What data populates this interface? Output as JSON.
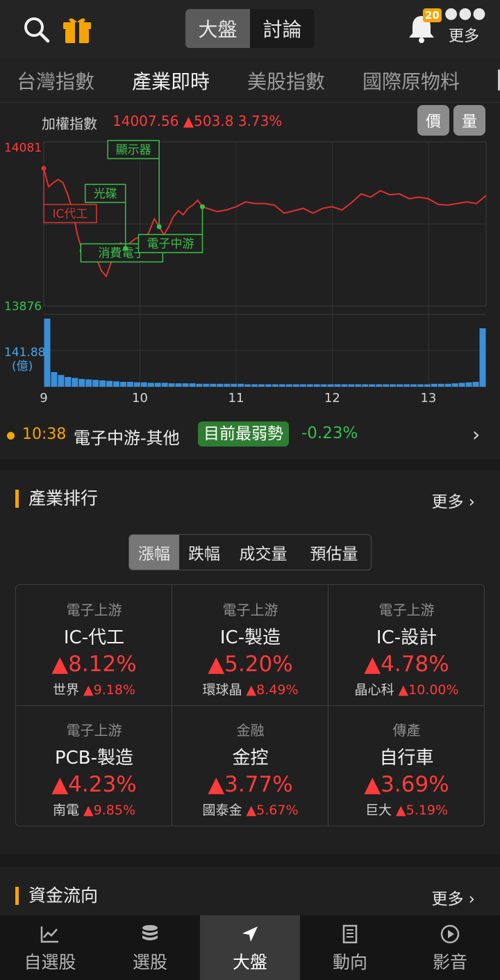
{
  "header": {
    "segments": [
      "大盤",
      "討論"
    ],
    "active_segment": "大盤",
    "notification_count": "20",
    "more_label": "更多"
  },
  "category_tabs": [
    "台灣指數",
    "產業即時",
    "美股指數",
    "國際原物料"
  ],
  "active_category": "產業即時",
  "chart_header": {
    "index_name": "加權指數",
    "index_value": "14007.56 ▲503.8 3.73%",
    "price_button": "價",
    "volume_button": "量"
  },
  "chart_data": {
    "type": "line",
    "ylim": [
      13876,
      14081
    ],
    "y_high_label": "14081",
    "y_low_label": "13876",
    "volume_max_label": "141.88",
    "volume_unit_label": "(億)",
    "x_ticks": [
      "9",
      "10",
      "11",
      "12",
      "13"
    ],
    "xlim": [
      9,
      13.6
    ],
    "series": [
      {
        "x": [
          9.0,
          9.05,
          9.1,
          9.15,
          9.2,
          9.25,
          9.3,
          9.35,
          9.4,
          9.45,
          9.5,
          9.55,
          9.6,
          9.65,
          9.7,
          9.75,
          9.8,
          9.85,
          9.9,
          9.95,
          10.0,
          10.05,
          10.1,
          10.15,
          10.2,
          10.25,
          10.3,
          10.35,
          10.4,
          10.45,
          10.5,
          10.55,
          10.6,
          10.65,
          10.7,
          10.8,
          10.9,
          11.0,
          11.1,
          11.2,
          11.3,
          11.4,
          11.5,
          11.6,
          11.7,
          11.8,
          11.9,
          12.0,
          12.1,
          12.2,
          12.3,
          12.4,
          12.5,
          12.6,
          12.7,
          12.8,
          12.9,
          13.0,
          13.1,
          13.2,
          13.3,
          13.4,
          13.5,
          13.6
        ],
        "values": [
          14048,
          14025,
          14030,
          14034,
          14030,
          14015,
          13995,
          13965,
          13945,
          13948,
          13940,
          13935,
          13920,
          13913,
          13930,
          13950,
          13955,
          13948,
          13955,
          13960,
          13962,
          13958,
          13970,
          13985,
          13975,
          13965,
          13975,
          13988,
          13995,
          13990,
          13998,
          14002,
          14008,
          14000,
          13998,
          13994,
          13996,
          14000,
          14006,
          14004,
          14004,
          14002,
          13992,
          13995,
          13998,
          13992,
          13998,
          14000,
          13996,
          14005,
          14016,
          14012,
          14020,
          14015,
          14016,
          14010,
          14012,
          14010,
          14003,
          14002,
          14004,
          14006,
          14004,
          14014
        ]
      }
    ],
    "volume": [
      140,
      30,
      24,
      20,
      18,
      16,
      15,
      14,
      13,
      12,
      11,
      10,
      10,
      9,
      9,
      8,
      8,
      8,
      7,
      7,
      7,
      7,
      6,
      6,
      6,
      6,
      6,
      6,
      6,
      5,
      5,
      5,
      5,
      5,
      5,
      5,
      5,
      5,
      5,
      5,
      5,
      5,
      5,
      5,
      5,
      5,
      5,
      5,
      5,
      5,
      5,
      5,
      5,
      5,
      5,
      5,
      6,
      6,
      6,
      7,
      8,
      9,
      10,
      120
    ],
    "annotations": [
      {
        "label": "IC代工",
        "x": 9.0,
        "value": 14048,
        "color": "#e03030"
      },
      {
        "label": "消費電子",
        "x": 9.4,
        "value": 13945,
        "color": "#3cbf4a"
      },
      {
        "label": "光碟",
        "x": 9.85,
        "value": 13948,
        "color": "#3cbf4a"
      },
      {
        "label": "顯示器",
        "x": 10.2,
        "value": 13975,
        "color": "#3cbf4a"
      },
      {
        "label": "電子中游",
        "x": 10.65,
        "value": 14000,
        "color": "#3cbf4a"
      }
    ]
  },
  "ticker": {
    "time": "10:38",
    "name": "電子中游-其他",
    "tag": "目前最弱勢",
    "change": "-0.23%"
  },
  "ranking": {
    "title": "產業排行",
    "more": "更多",
    "filters": [
      "漲幅",
      "跌幅",
      "成交量",
      "預估量"
    ],
    "active_filter": "漲幅",
    "items": [
      {
        "group": "電子上游",
        "industry": "IC-代工",
        "change": "▲8.12%",
        "leader": "世界",
        "leader_change": "▲9.18%"
      },
      {
        "group": "電子上游",
        "industry": "IC-製造",
        "change": "▲5.20%",
        "leader": "環球晶",
        "leader_change": "▲8.49%"
      },
      {
        "group": "電子上游",
        "industry": "IC-設計",
        "change": "▲4.78%",
        "leader": "晶心科",
        "leader_change": "▲10.00%"
      },
      {
        "group": "電子上游",
        "industry": "PCB-製造",
        "change": "▲4.23%",
        "leader": "南電",
        "leader_change": "▲9.85%"
      },
      {
        "group": "金融",
        "industry": "金控",
        "change": "▲3.77%",
        "leader": "國泰金",
        "leader_change": "▲5.67%"
      },
      {
        "group": "傳產",
        "industry": "自行車",
        "change": "▲3.69%",
        "leader": "巨大",
        "leader_change": "▲5.19%"
      }
    ]
  },
  "capital_flow": {
    "title": "資金流向",
    "more": "更多"
  },
  "bottom_nav": [
    {
      "label": "自選股",
      "icon": "chart-line-icon"
    },
    {
      "label": "選股",
      "icon": "database-icon"
    },
    {
      "label": "大盤",
      "icon": "navigation-arrow-icon"
    },
    {
      "label": "動向",
      "icon": "building-icon"
    },
    {
      "label": "影音",
      "icon": "play-circle-icon"
    }
  ],
  "active_nav": "大盤",
  "colors": {
    "up": "#ff3b3b",
    "down": "#33c14f",
    "accent": "#f6a400",
    "volume": "#3a8fd8"
  }
}
